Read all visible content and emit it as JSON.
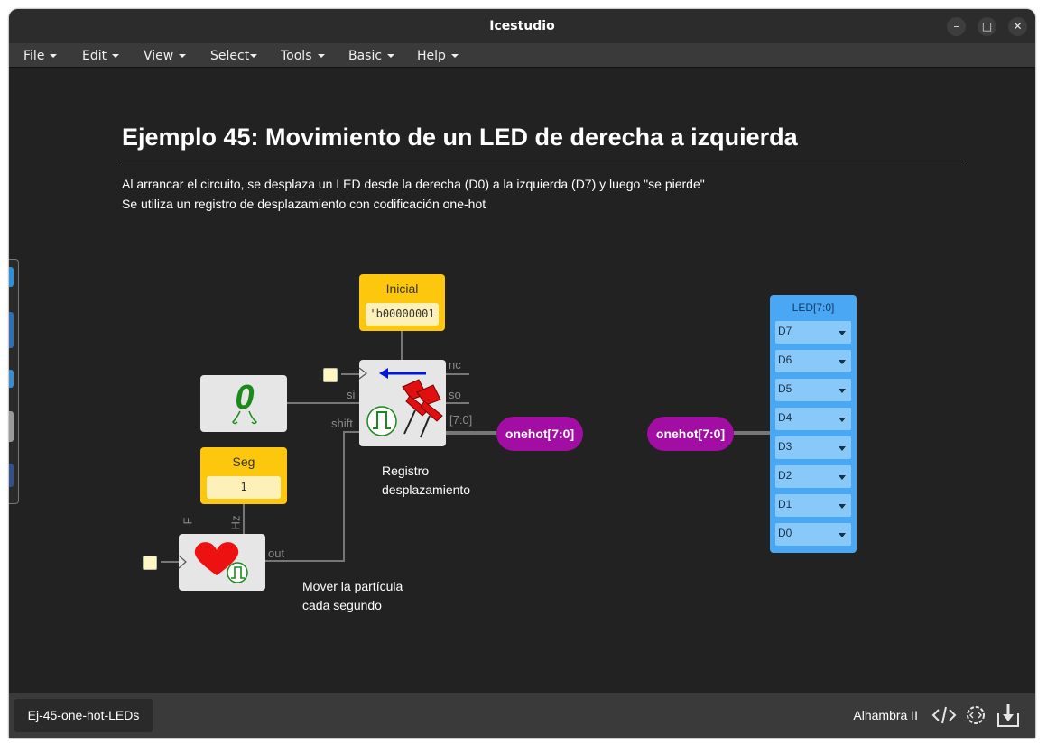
{
  "window": {
    "title": "Icestudio"
  },
  "window_controls": {
    "minimize": "–",
    "maximize": "□",
    "close": "✕"
  },
  "menu": [
    "File",
    "Edit",
    "View",
    "Select",
    "Tools",
    "Basic",
    "Help"
  ],
  "canvas": {
    "heading": "Ejemplo 45: Movimiento de un LED de derecha a izquierda",
    "description_line1": "Al arrancar el circuito, se desplaza un LED desde la derecha (D0) a la izquierda (D7) y luego \"se pierde\"",
    "description_line2": "Se utiliza un registro de desplazamiento con codificación one-hot",
    "inicial": {
      "label": "Inicial",
      "value": "'b00000001"
    },
    "seg": {
      "label": "Seg",
      "value": "1"
    },
    "shift_register": {
      "ports": {
        "nc": "nc",
        "si": "si",
        "so": "so",
        "shift": "shift",
        "out_bus": "[7:0]"
      },
      "caption_line1": "Registro",
      "caption_line2": "desplazamiento"
    },
    "heartbeat": {
      "ports": {
        "f": "F",
        "hz": "Hz",
        "out": "out"
      },
      "caption_line1": "Mover la partícula",
      "caption_line2": "cada segundo"
    },
    "label_out": "onehot[7:0]",
    "label_in": "onehot[7:0]",
    "led": {
      "header": "LED[7:0]",
      "pins": [
        "D7",
        "D6",
        "D5",
        "D4",
        "D3",
        "D2",
        "D1",
        "D0"
      ]
    },
    "colors": {
      "constant": "#fdc70d",
      "label": "#a20ea3",
      "led_block": "#4aa7f3",
      "wire": "#777777"
    }
  },
  "footer": {
    "tab": "Ej-45-one-hot-LEDs",
    "board": "Alhambra II",
    "icons": [
      "code-icon",
      "settings-icon",
      "download-icon"
    ]
  }
}
